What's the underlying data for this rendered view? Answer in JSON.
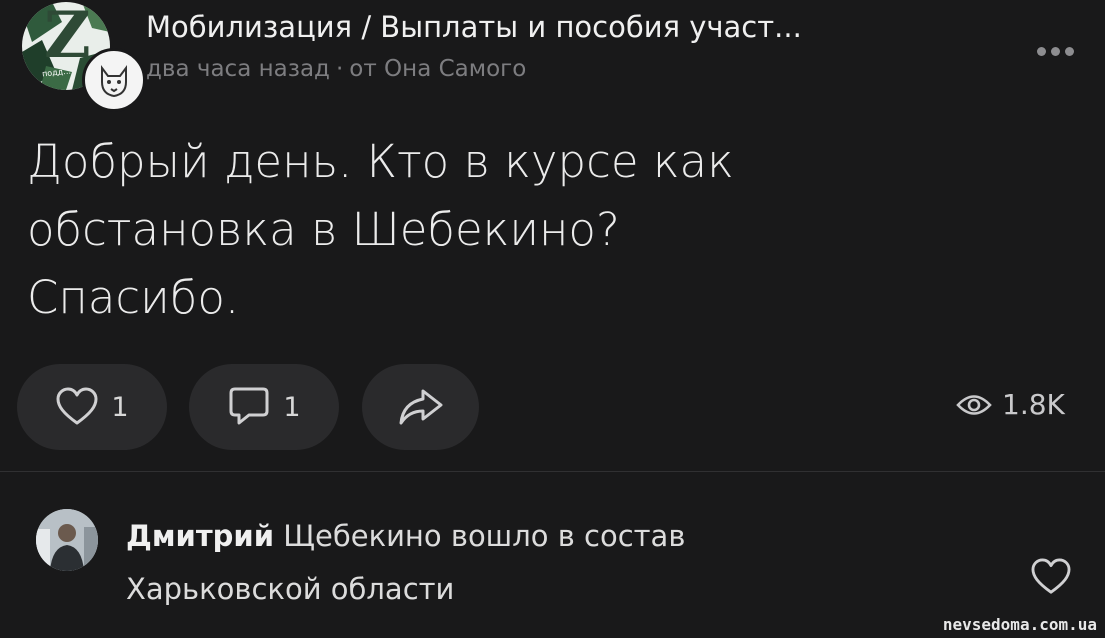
{
  "header": {
    "group_title": "Мобилизация / Выплаты и пособия участ...",
    "time": "два часа назад",
    "separator": "·",
    "author": "от Она Самого",
    "avatar_letter": "Z",
    "avatar_caption": "подд..."
  },
  "post": {
    "lines": [
      "Добрый день. Кто в курсе как",
      "обстановка в Шебекино?",
      "Спасибо."
    ]
  },
  "actions": {
    "likes": "1",
    "comments": "1",
    "views": "1.8K",
    "icons": {
      "like": "heart-icon",
      "comment": "comment-icon",
      "share": "share-icon",
      "views": "eye-icon",
      "more": "more-icon"
    }
  },
  "comment": {
    "author": "Дмитрий",
    "text_line1": "Щебекино вошло в состав",
    "text_line2": "Харьковской области"
  },
  "watermark": "nevsedoma.com.ua",
  "colors": {
    "background": "#19191a",
    "pill": "#2a2a2c",
    "muted": "#7d7d80"
  }
}
